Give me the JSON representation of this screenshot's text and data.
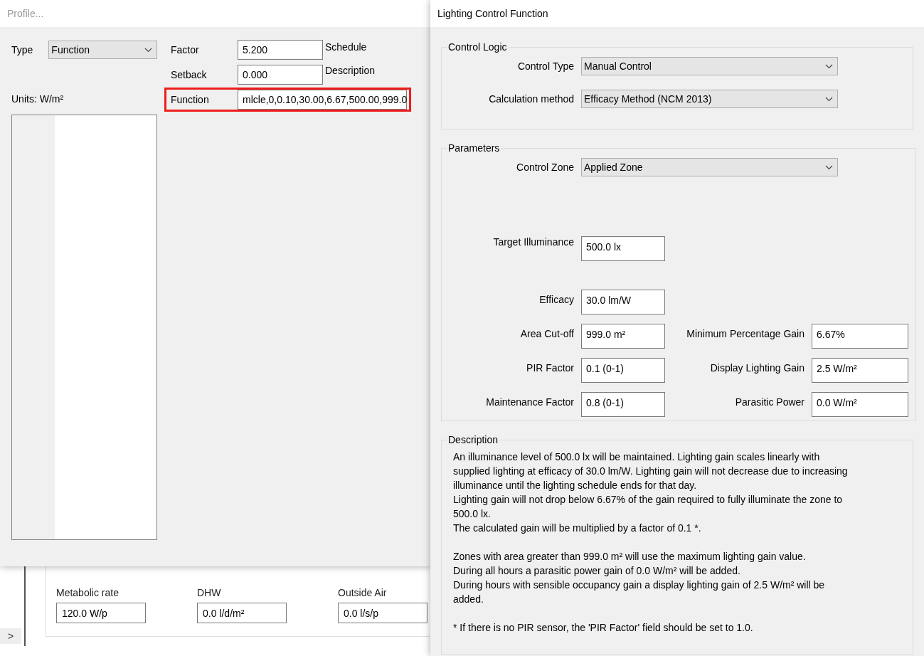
{
  "background_window": {
    "fields": [
      {
        "label": "Metabolic rate",
        "value": "120.0 W/p"
      },
      {
        "label": "DHW",
        "value": "0.0 l/d/m²"
      },
      {
        "label": "Outside Air",
        "value": "0.0 l/s/p"
      }
    ],
    "expander": ">"
  },
  "profile_window": {
    "title": "Profile...",
    "type": {
      "label": "Type",
      "value": "Function"
    },
    "units": "Units: W/m²",
    "fields": [
      {
        "label": "Factor",
        "value": "5.200",
        "highlighted": false
      },
      {
        "label": "Setback",
        "value": "0.000",
        "highlighted": false
      },
      {
        "label": "Function",
        "value": "mlcle,0,0.10,30.00,6.67,500.00,999.0",
        "highlighted": true
      }
    ],
    "side_labels": [
      "Schedule",
      "Description"
    ]
  },
  "lighting_window": {
    "title": "Lighting Control Function",
    "control_logic": {
      "title": "Control Logic",
      "rows": [
        {
          "label": "Control Type",
          "value": "Manual Control"
        },
        {
          "label": "Calculation method",
          "value": "Efficacy Method (NCM 2013)"
        }
      ]
    },
    "parameters": {
      "title": "Parameters",
      "control_zone": {
        "label": "Control Zone",
        "value": "Applied Zone"
      },
      "target": {
        "label": "Target Illuminance",
        "value": "500.0 lx"
      },
      "left": [
        {
          "label": "Efficacy",
          "value": "30.0 lm/W"
        },
        {
          "label": "Area Cut-off",
          "value": "999.0 m²"
        },
        {
          "label": "PIR Factor",
          "value": "0.1 (0-1)"
        },
        {
          "label": "Maintenance Factor",
          "value": "0.8 (0-1)"
        }
      ],
      "right": [
        {
          "label": "Minimum Percentage Gain",
          "value": "6.67%"
        },
        {
          "label": "Display Lighting Gain",
          "value": "2.5 W/m²"
        },
        {
          "label": "Parasitic Power",
          "value": "0.0 W/m²"
        }
      ]
    },
    "description": {
      "title": "Description",
      "groups": [
        [
          "An illuminance level of 500.0 lx will be maintained. Lighting gain scales linearly with supplied lighting at efficacy of 30.0 lm/W. Lighting gain will not decrease due to increasing illuminance until the lighting schedule ends for that day.",
          "Lighting gain will not drop below 6.67% of the gain required to fully illuminate the zone to 500.0 lx.",
          "The calculated gain will be multiplied by a factor of 0.1 *."
        ],
        [
          "Zones with area greater than 999.0 m² will use the maximum lighting gain value.",
          "During all hours a parasitic power gain of 0.0 W/m² will be added.",
          "During hours with sensible occupancy gain a display lighting gain of 2.5 W/m² will be added."
        ],
        [
          "* If there is no PIR sensor, the 'PIR Factor' field should be set to 1.0."
        ]
      ]
    }
  }
}
